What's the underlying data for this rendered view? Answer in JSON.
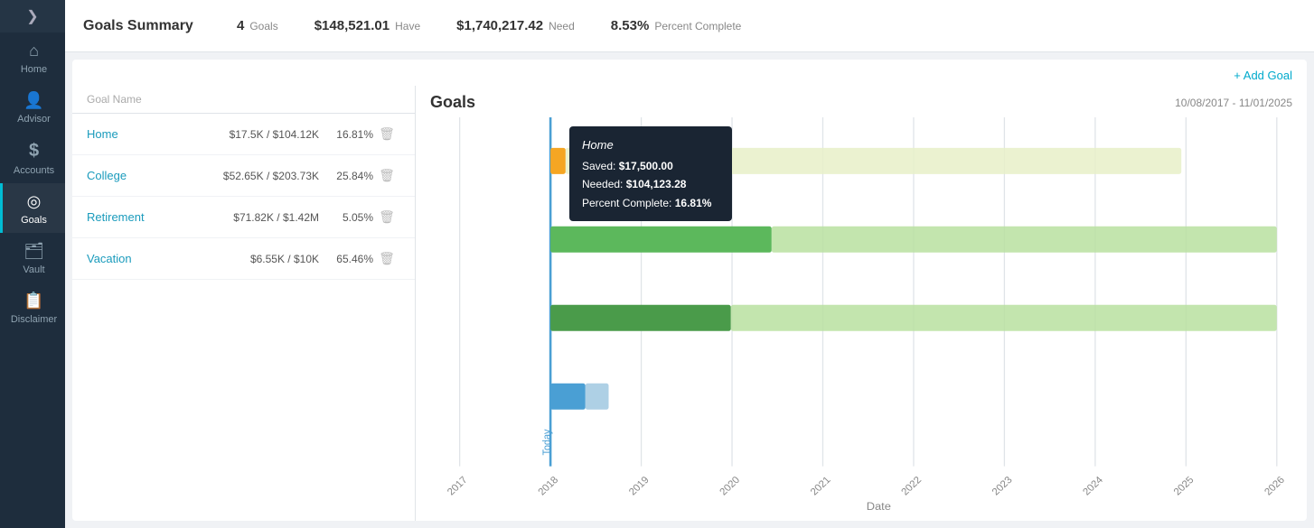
{
  "sidebar": {
    "toggle_icon": "❯",
    "items": [
      {
        "id": "home",
        "label": "Home",
        "icon": "⌂",
        "active": false
      },
      {
        "id": "advisor",
        "label": "Advisor",
        "icon": "👤",
        "active": false
      },
      {
        "id": "accounts",
        "label": "Accounts",
        "icon": "$",
        "active": false
      },
      {
        "id": "goals",
        "label": "Goals",
        "icon": "◎",
        "active": true
      },
      {
        "id": "vault",
        "label": "Vault",
        "icon": "🗂",
        "active": false
      },
      {
        "id": "disclaimer",
        "label": "Disclaimer",
        "icon": "📋",
        "active": false
      }
    ]
  },
  "summary": {
    "title": "Goals Summary",
    "goals_count": "4",
    "goals_label": "Goals",
    "have_value": "$148,521.01",
    "have_label": "Have",
    "need_value": "$1,740,217.42",
    "need_label": "Need",
    "pct_value": "8.53%",
    "pct_label": "Percent Complete"
  },
  "chart": {
    "add_goal_label": "+ Add Goal",
    "title": "Goals",
    "date_range": "10/08/2017  -  11/01/2025"
  },
  "table": {
    "col_name": "Goal Name",
    "col_amount": "",
    "col_pct": "",
    "rows": [
      {
        "id": "home",
        "name": "Home",
        "amount": "$17.5K / $104.12K",
        "pct": "16.81%"
      },
      {
        "id": "college",
        "name": "College",
        "amount": "$52.65K / $203.73K",
        "pct": "25.84%"
      },
      {
        "id": "retirement",
        "name": "Retirement",
        "amount": "$71.82K / $1.42M",
        "pct": "5.05%"
      },
      {
        "id": "vacation",
        "name": "Vacation",
        "amount": "$6.55K / $10K",
        "pct": "65.46%"
      }
    ]
  },
  "tooltip": {
    "title": "Home",
    "saved_label": "Saved:",
    "saved_value": "$17,500.00",
    "needed_label": "Needed:",
    "needed_value": "$104,123.28",
    "pct_label": "Percent Complete:",
    "pct_value": "16.81%"
  },
  "xaxis": {
    "labels": [
      "2017",
      "2018",
      "2019",
      "2020",
      "2021",
      "2022",
      "2023",
      "2024",
      "2025",
      "2026"
    ],
    "date_label": "Date"
  }
}
